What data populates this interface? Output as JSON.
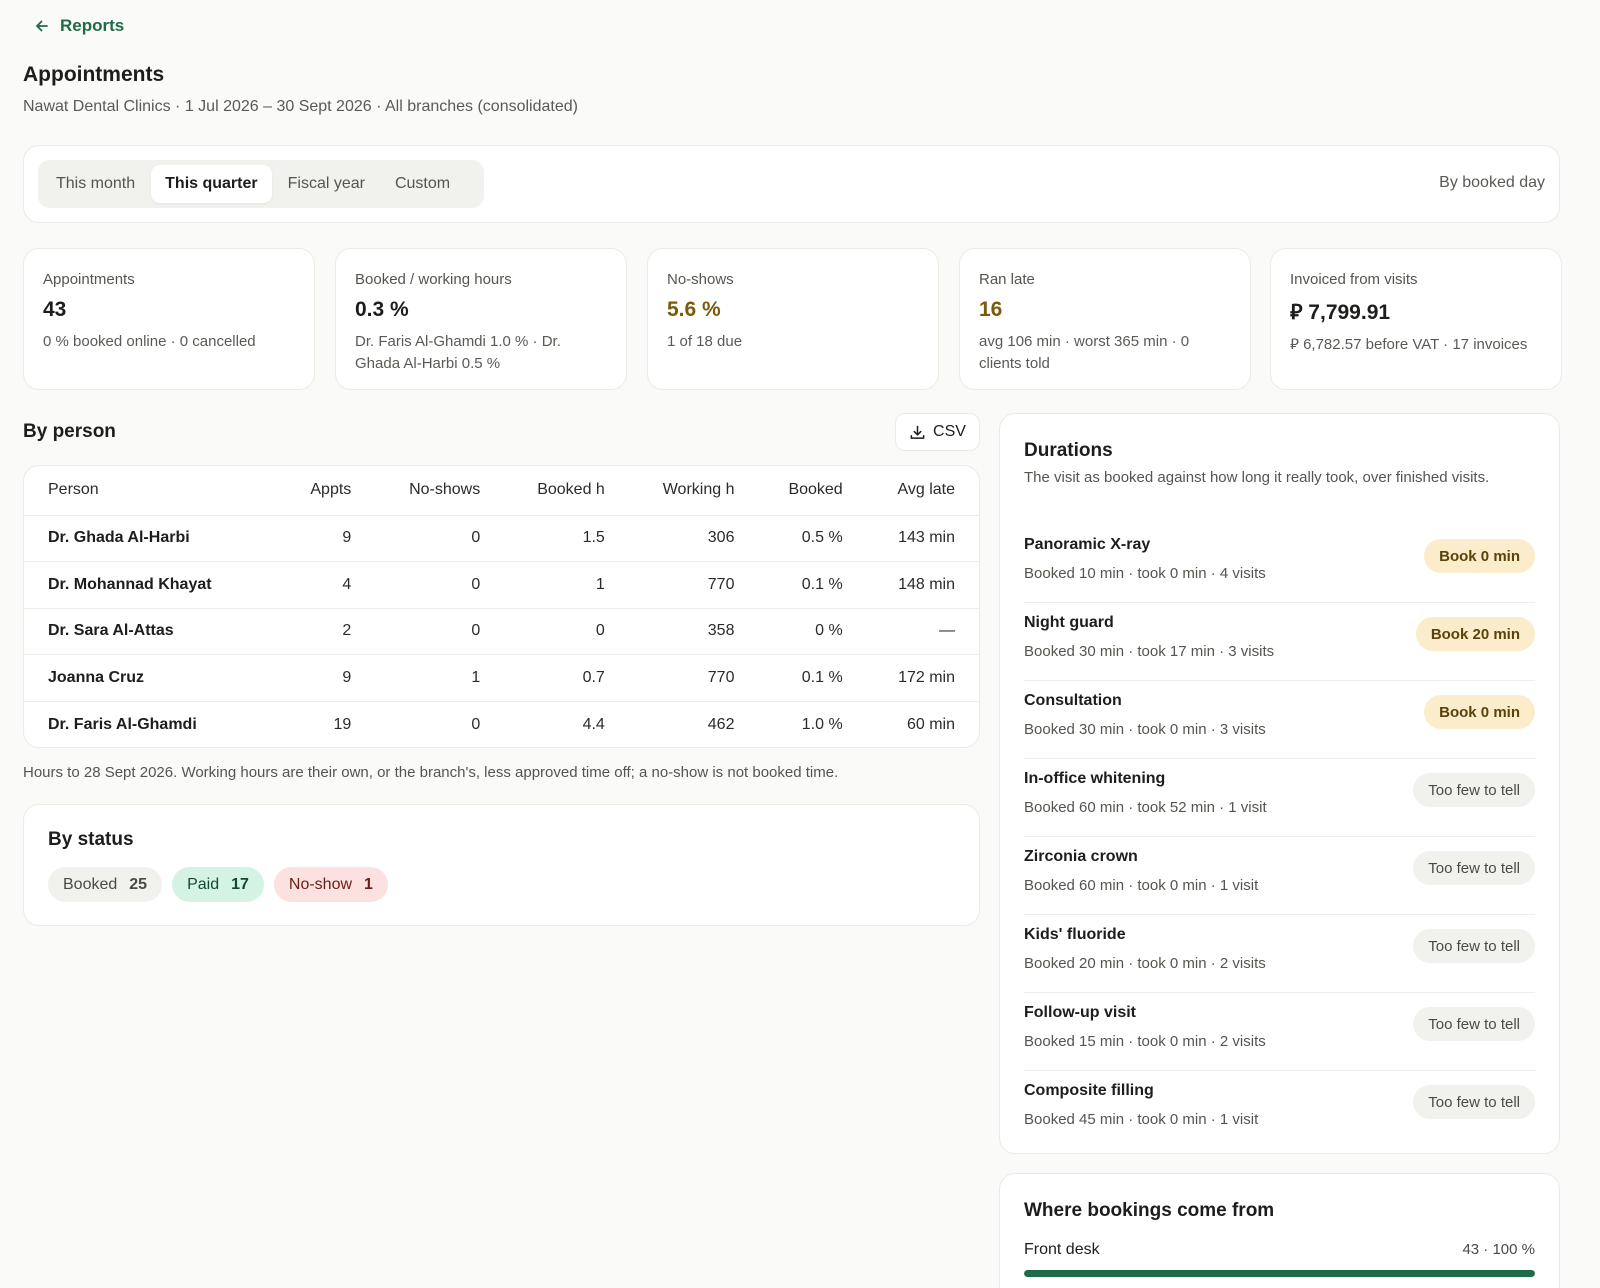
{
  "nav": {
    "back_label": "Reports"
  },
  "header": {
    "title": "Appointments",
    "subtitle": "Nawat Dental Clinics · 1 Jul 2026 – 30 Sept 2026 · All branches (consolidated)"
  },
  "filters": {
    "periods": [
      {
        "label": "This month",
        "active": false
      },
      {
        "label": "This quarter",
        "active": true
      },
      {
        "label": "Fiscal year",
        "active": false
      },
      {
        "label": "Custom",
        "active": false
      }
    ],
    "grouping": "By booked day"
  },
  "kpis": [
    {
      "label": "Appointments",
      "value": "43",
      "note": "0 % booked online · 0 cancelled"
    },
    {
      "label": "Booked / working hours",
      "value": "0.3 %",
      "note": "Dr. Faris Al-Ghamdi 1.0 % · Dr. Ghada Al-Harbi 0.5 %"
    },
    {
      "label": "No-shows",
      "value": "5.6 %",
      "note": "1 of 18 due"
    },
    {
      "label": "Ran late",
      "value": "16",
      "note": "avg 106 min · worst 365 min · 0 clients told"
    },
    {
      "label": "Invoiced from visits",
      "value": "⃁ 7,799.91",
      "note": "⃁ 6,782.57 before VAT · 17 invoices"
    }
  ],
  "by_person": {
    "title": "By person",
    "csv_label": "CSV",
    "columns": [
      "Person",
      "Appts",
      "No-shows",
      "Booked h",
      "Working h",
      "Booked",
      "Avg late"
    ],
    "rows": [
      [
        "Dr. Ghada Al-Harbi",
        "9",
        "0",
        "1.5",
        "306",
        "0.5 %",
        "143 min"
      ],
      [
        "Dr. Mohannad Khayat",
        "4",
        "0",
        "1",
        "770",
        "0.1 %",
        "148 min"
      ],
      [
        "Dr. Sara Al-Attas",
        "2",
        "0",
        "0",
        "358",
        "0 %",
        "—"
      ],
      [
        "Joanna Cruz",
        "9",
        "1",
        "0.7",
        "770",
        "0.1 %",
        "172 min"
      ],
      [
        "Dr. Faris Al-Ghamdi",
        "19",
        "0",
        "4.4",
        "462",
        "1.0 %",
        "60 min"
      ]
    ],
    "note": "Hours to 28 Sept 2026. Working hours are their own, or the branch's, less approved time off; a no-show is not booked time."
  },
  "by_status": {
    "title": "By status",
    "chips": [
      {
        "label": "Booked",
        "count": "25"
      },
      {
        "label": "Paid",
        "count": "17"
      },
      {
        "label": "No-show",
        "count": "1"
      }
    ]
  },
  "durations": {
    "title": "Durations",
    "description": "The visit as booked against how long it really took, over finished visits.",
    "items": [
      {
        "name": "Panoramic X-ray",
        "meta": "Booked 10 min · took 0 min · 4 visits",
        "badge": "Book 0 min"
      },
      {
        "name": "Night guard",
        "meta": "Booked 30 min · took 17 min · 3 visits",
        "badge": "Book 20 min"
      },
      {
        "name": "Consultation",
        "meta": "Booked 30 min · took 0 min · 3 visits",
        "badge": "Book 0 min"
      },
      {
        "name": "In-office whitening",
        "meta": "Booked 60 min · took 52 min · 1 visit",
        "badge": "Too few to tell"
      },
      {
        "name": "Zirconia crown",
        "meta": "Booked 60 min · took 0 min · 1 visit",
        "badge": "Too few to tell"
      },
      {
        "name": "Kids' fluoride",
        "meta": "Booked 20 min · took 0 min · 2 visits",
        "badge": "Too few to tell"
      },
      {
        "name": "Follow-up visit",
        "meta": "Booked 15 min · took 0 min · 2 visits",
        "badge": "Too few to tell"
      },
      {
        "name": "Composite filling",
        "meta": "Booked 45 min · took 0 min · 1 visit",
        "badge": "Too few to tell"
      }
    ]
  },
  "sources": {
    "title": "Where bookings come from",
    "items": [
      {
        "label": "Front desk",
        "value": "43 · 100 %",
        "share": 1.0
      }
    ]
  },
  "colors": {
    "accent": "#1e6b46",
    "warn_text": "#7a5b0c",
    "paid_bg": "#d5f3e4",
    "noshow_bg": "#fbe1df",
    "book_badge_bg": "#fbeccb"
  }
}
